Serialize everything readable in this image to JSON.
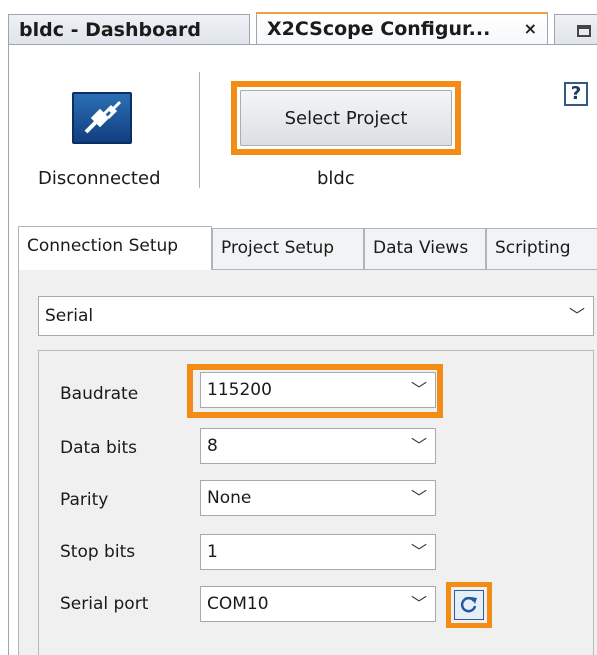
{
  "editor_tabs": [
    {
      "label": "bldc - Dashboard"
    },
    {
      "label": "X2CScope Configur...",
      "close": "×"
    }
  ],
  "connection": {
    "status": "Disconnected",
    "icon": "connection-plug-icon"
  },
  "project": {
    "select_label": "Select Project",
    "name": "bldc"
  },
  "help": {
    "label": "?"
  },
  "subtabs": [
    "Connection Setup",
    "Project Setup",
    "Data Views",
    "Scripting"
  ],
  "active_subtab": "Connection Setup",
  "connection_type": {
    "selected": "Serial"
  },
  "serial_settings": {
    "baudrate": {
      "label": "Baudrate",
      "value": "115200"
    },
    "data_bits": {
      "label": "Data bits",
      "value": "8"
    },
    "parity": {
      "label": "Parity",
      "value": "None"
    },
    "stop_bits": {
      "label": "Stop bits",
      "value": "1"
    },
    "serial_port": {
      "label": "Serial port",
      "value": "COM10"
    }
  },
  "colors": {
    "highlight": "#f28c14",
    "connect_icon": "#1f5aa0"
  }
}
